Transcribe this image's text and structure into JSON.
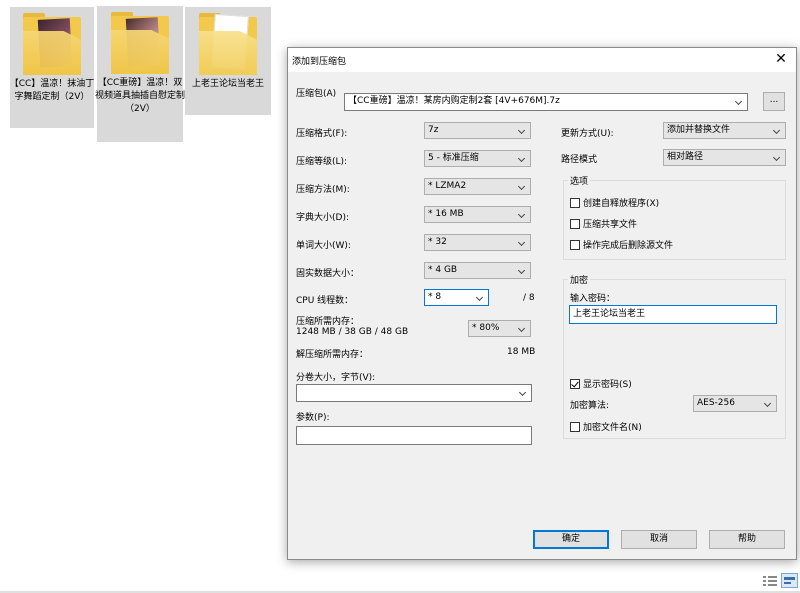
{
  "desktop": {
    "items": [
      {
        "label": "【CC】温凉！抹油丁字舞蹈定制（2V）"
      },
      {
        "label": "【CC重磅】温凉！双视频道具抽插自慰定制（2V）"
      },
      {
        "label": "上老王论坛当老王"
      }
    ]
  },
  "dialog": {
    "title": "添加到压缩包",
    "archive_label": "压缩包(A)",
    "archive_value": "【CC重磅】温凉！某房内购定制2套 [4V+676M].7z",
    "browse_label": "...",
    "left": {
      "format_label": "压缩格式(F):",
      "format_value": "7z",
      "level_label": "压缩等级(L):",
      "level_value": "5 - 标准压缩",
      "method_label": "压缩方法(M):",
      "method_value": "* LZMA2",
      "dict_label": "字典大小(D):",
      "dict_value": "* 16 MB",
      "word_label": "单词大小(W):",
      "word_value": "* 32",
      "solid_label": "固实数据大小：",
      "solid_value": "* 4 GB",
      "threads_label": "CPU 线程数：",
      "threads_value": "* 8",
      "threads_max": "/ 8",
      "mem_label": "压缩所需内存：",
      "mem_detail": "1248 MB / 38 GB / 48 GB",
      "mem_percent": "* 80%",
      "decomp_label": "解压缩所需内存：",
      "decomp_value": "18 MB",
      "volume_label": "分卷大小，字节(V):",
      "volume_value": "",
      "params_label": "参数(P):",
      "params_value": ""
    },
    "right": {
      "update_label": "更新方式(U):",
      "update_value": "添加并替换文件",
      "path_label": "路径模式",
      "path_value": "相对路径",
      "options_title": "选项",
      "opt_sfx": "创建自释放程序(X)",
      "opt_shared": "压缩共享文件",
      "opt_delete": "操作完成后删除源文件",
      "encrypt_title": "加密",
      "password_label": "输入密码：",
      "password_value": "上老王论坛当老王",
      "show_password": "显示密码(S)",
      "algo_label": "加密算法:",
      "algo_value": "AES-256",
      "encrypt_names": "加密文件名(N)"
    },
    "buttons": {
      "ok": "确定",
      "cancel": "取消",
      "help": "帮助"
    }
  },
  "colors": {
    "accent": "#0078d7",
    "folder": "#f2c94c",
    "selected": "#d9d9d9"
  }
}
